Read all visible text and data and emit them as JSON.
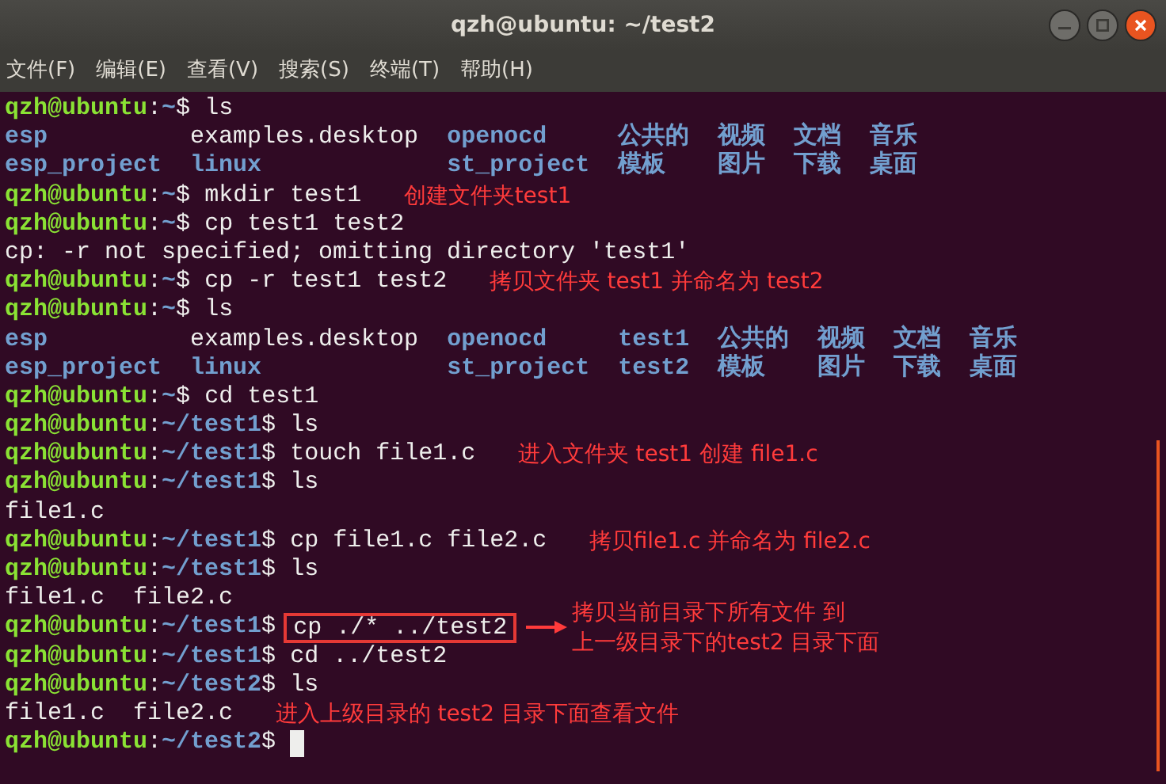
{
  "window": {
    "title": "qzh@ubuntu: ~/test2"
  },
  "menu": [
    "文件(F)",
    "编辑(E)",
    "查看(V)",
    "搜索(S)",
    "终端(T)",
    "帮助(H)"
  ],
  "terminal": {
    "lines": [
      {
        "kind": "prompt",
        "user": "qzh@ubuntu",
        "sep": ":",
        "path": "~",
        "end": "$",
        "command": "ls"
      },
      {
        "kind": "listing",
        "rows": [
          [
            {
              "text": "esp",
              "kind": "dir"
            },
            {
              "text": "examples.desktop",
              "kind": "file"
            },
            {
              "text": "openocd",
              "kind": "dir"
            },
            {
              "text": "公共的",
              "kind": "dir"
            },
            {
              "text": "视频",
              "kind": "dir"
            },
            {
              "text": "文档",
              "kind": "dir"
            },
            {
              "text": "音乐",
              "kind": "dir"
            }
          ],
          [
            {
              "text": "esp_project",
              "kind": "dir"
            },
            {
              "text": "linux",
              "kind": "dir"
            },
            {
              "text": "st_project",
              "kind": "dir"
            },
            {
              "text": "模板",
              "kind": "dir"
            },
            {
              "text": "图片",
              "kind": "dir"
            },
            {
              "text": "下载",
              "kind": "dir"
            },
            {
              "text": "桌面",
              "kind": "dir"
            }
          ]
        ]
      },
      {
        "kind": "prompt",
        "user": "qzh@ubuntu",
        "sep": ":",
        "path": "~",
        "end": "$",
        "command": "mkdir test1",
        "note": "创建文件夹test1"
      },
      {
        "kind": "prompt",
        "user": "qzh@ubuntu",
        "sep": ":",
        "path": "~",
        "end": "$",
        "command": "cp test1 test2"
      },
      {
        "kind": "output",
        "text": "cp: -r not specified; omitting directory 'test1'"
      },
      {
        "kind": "prompt",
        "user": "qzh@ubuntu",
        "sep": ":",
        "path": "~",
        "end": "$",
        "command": "cp -r test1 test2",
        "note": "拷贝文件夹 test1 并命名为 test2"
      },
      {
        "kind": "prompt",
        "user": "qzh@ubuntu",
        "sep": ":",
        "path": "~",
        "end": "$",
        "command": "ls"
      },
      {
        "kind": "listing",
        "rows": [
          [
            {
              "text": "esp",
              "kind": "dir"
            },
            {
              "text": "examples.desktop",
              "kind": "file"
            },
            {
              "text": "openocd",
              "kind": "dir"
            },
            {
              "text": "test1",
              "kind": "dir"
            },
            {
              "text": "公共的",
              "kind": "dir"
            },
            {
              "text": "视频",
              "kind": "dir"
            },
            {
              "text": "文档",
              "kind": "dir"
            },
            {
              "text": "音乐",
              "kind": "dir"
            }
          ],
          [
            {
              "text": "esp_project",
              "kind": "dir"
            },
            {
              "text": "linux",
              "kind": "dir"
            },
            {
              "text": "st_project",
              "kind": "dir"
            },
            {
              "text": "test2",
              "kind": "dir"
            },
            {
              "text": "模板",
              "kind": "dir"
            },
            {
              "text": "图片",
              "kind": "dir"
            },
            {
              "text": "下载",
              "kind": "dir"
            },
            {
              "text": "桌面",
              "kind": "dir"
            }
          ]
        ]
      },
      {
        "kind": "prompt",
        "user": "qzh@ubuntu",
        "sep": ":",
        "path": "~",
        "end": "$",
        "command": "cd test1"
      },
      {
        "kind": "prompt",
        "user": "qzh@ubuntu",
        "sep": ":",
        "path": "~/test1",
        "end": "$",
        "command": "ls"
      },
      {
        "kind": "prompt",
        "user": "qzh@ubuntu",
        "sep": ":",
        "path": "~/test1",
        "end": "$",
        "command": "touch file1.c",
        "note": "进入文件夹 test1 创建 file1.c"
      },
      {
        "kind": "prompt",
        "user": "qzh@ubuntu",
        "sep": ":",
        "path": "~/test1",
        "end": "$",
        "command": "ls"
      },
      {
        "kind": "output",
        "text": "file1.c"
      },
      {
        "kind": "prompt",
        "user": "qzh@ubuntu",
        "sep": ":",
        "path": "~/test1",
        "end": "$",
        "command": "cp file1.c file2.c",
        "note": "拷贝file1.c 并命名为 file2.c"
      },
      {
        "kind": "prompt",
        "user": "qzh@ubuntu",
        "sep": ":",
        "path": "~/test1",
        "end": "$",
        "command": "ls"
      },
      {
        "kind": "output",
        "text": "file1.c  file2.c"
      },
      {
        "kind": "prompt",
        "user": "qzh@ubuntu",
        "sep": ":",
        "path": "~/test1",
        "end": "$",
        "command": "cp ./* ../test2",
        "highlighted": true,
        "note": [
          "拷贝当前目录下所有文件 到",
          "上一级目录下的test2 目录下面"
        ]
      },
      {
        "kind": "prompt",
        "user": "qzh@ubuntu",
        "sep": ":",
        "path": "~/test1",
        "end": "$",
        "command": "cd ../test2"
      },
      {
        "kind": "prompt",
        "user": "qzh@ubuntu",
        "sep": ":",
        "path": "~/test2",
        "end": "$",
        "command": "ls"
      },
      {
        "kind": "output",
        "text": "file1.c  file2.c",
        "note": "进入上级目录的 test2 目录下面查看文件"
      },
      {
        "kind": "prompt",
        "user": "qzh@ubuntu",
        "sep": ":",
        "path": "~/test2",
        "end": "$",
        "cursor": true
      }
    ]
  }
}
